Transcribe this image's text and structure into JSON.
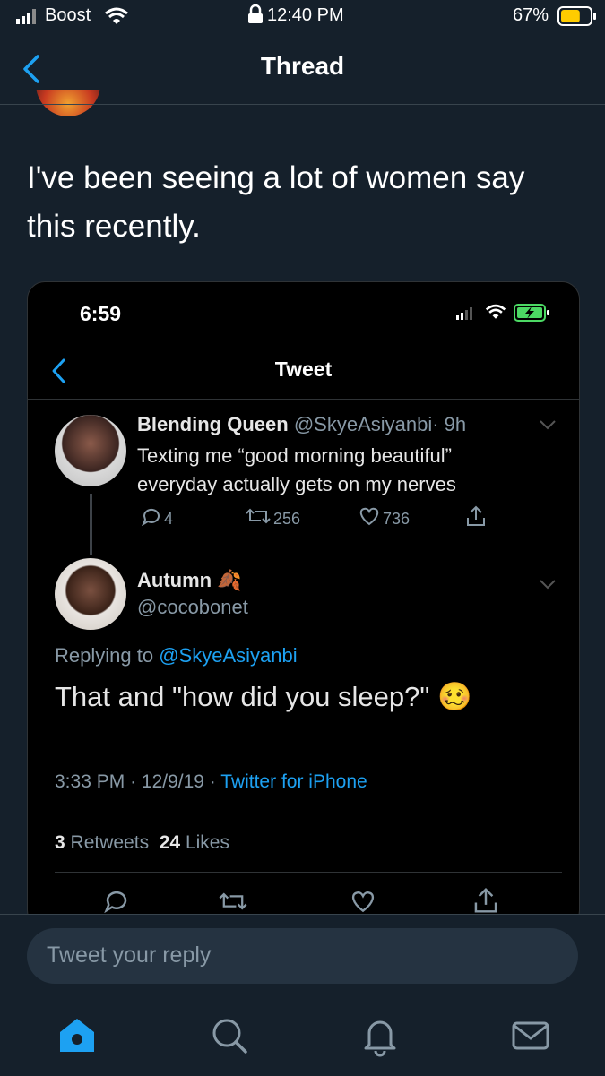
{
  "status_bar": {
    "carrier": "Boost",
    "time": "12:40 PM",
    "battery": "67%",
    "battery_level": 0.67
  },
  "nav": {
    "back_icon": "chevron-left-icon",
    "title": "Thread"
  },
  "tweet": {
    "text_line1": "I've been seeing a lot of women say",
    "text_line2": "this recently."
  },
  "embedded_screenshot": {
    "status_time": "6:59",
    "title": "Tweet",
    "parent_tweet": {
      "display_name": "Blending Queen",
      "handle": "@SkyeAsiyanbi",
      "age": "· 9h",
      "text_line1": "Texting me “good morning beautiful”",
      "text_line2": "everyday actually gets on my nerves",
      "replies": "4",
      "retweets": "256",
      "likes": "736"
    },
    "reply_tweet": {
      "display_name": "Autumn",
      "name_emoji": "🍂",
      "handle": "@cocobonet",
      "replying_prefix": "Replying to",
      "replying_to": "@SkyeAsiyanbi",
      "text": "That and \"how did you sleep?\"",
      "emoji": "🥴",
      "time": "3:33 PM",
      "date": "· 12/9/19 ·",
      "source": "Twitter for iPhone",
      "retweet_count": "3",
      "retweet_label": "Retweets",
      "like_count": "24",
      "like_label": "Likes"
    }
  },
  "reply_bar": {
    "placeholder": "Tweet your reply"
  },
  "tabs": [
    "home-icon",
    "search-icon",
    "notifications-icon",
    "messages-icon"
  ],
  "colors": {
    "background": "#15202b",
    "accent": "#1da1f2",
    "embed_background": "#000000",
    "battery_fill": "#ffcc00"
  }
}
